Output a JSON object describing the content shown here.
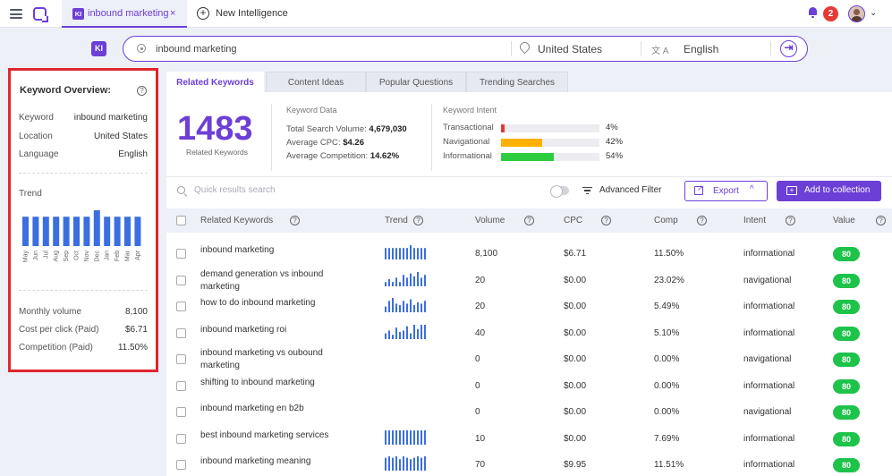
{
  "header": {
    "active_tab": {
      "badge": "KI",
      "label": "inbound marketing",
      "close": "×"
    },
    "new_tab_label": "New Intelligence",
    "new_tab_icon": "+",
    "notification_count": "2",
    "avatar_caret": "⌄"
  },
  "search": {
    "badge": "KI",
    "keyword": "inbound marketing",
    "location": "United States",
    "language_icon": "文 A",
    "language": "English",
    "submit_icon": "⇥"
  },
  "overview": {
    "title": "Keyword Overview:",
    "help": "?",
    "keyword_label": "Keyword",
    "keyword_value": "inbound marketing",
    "location_label": "Location",
    "location_value": "United States",
    "language_label": "Language",
    "language_value": "English",
    "trend_label": "Trend",
    "trend_months": [
      "May",
      "Jun",
      "Jul",
      "Aug",
      "Sep",
      "Oct",
      "Nov",
      "Dec",
      "Jan",
      "Feb",
      "Mar",
      "Apr"
    ],
    "trend_values": [
      0.82,
      0.82,
      0.82,
      0.82,
      0.82,
      0.82,
      0.82,
      1.0,
      0.82,
      0.82,
      0.82,
      0.82
    ],
    "monthly_volume_label": "Monthly volume",
    "monthly_volume_value": "8,100",
    "cpc_label": "Cost per click (Paid)",
    "cpc_value": "$6.71",
    "competition_label": "Competition (Paid)",
    "competition_value": "11.50%"
  },
  "tabs": [
    {
      "label": "Related Keywords",
      "active": true
    },
    {
      "label": "Content Ideas",
      "active": false
    },
    {
      "label": "Popular Questions",
      "active": false
    },
    {
      "label": "Trending Searches",
      "active": false
    }
  ],
  "summary": {
    "count": "1483",
    "count_label": "Related Keywords",
    "keyword_data_title": "Keyword Data",
    "total_volume_label": "Total Search Volume:",
    "total_volume_value": "4,679,030",
    "avg_cpc_label": "Average CPC:",
    "avg_cpc_value": "$4.26",
    "avg_comp_label": "Average Competition:",
    "avg_comp_value": "14.62%",
    "intent_title": "Keyword Intent",
    "intents": [
      {
        "label": "Transactional",
        "percent": "4%",
        "fraction": 0.04,
        "color": "#e53935"
      },
      {
        "label": "Navigational",
        "percent": "42%",
        "fraction": 0.42,
        "color": "#ffb000"
      },
      {
        "label": "Informational",
        "percent": "54%",
        "fraction": 0.54,
        "color": "#2ecc40"
      }
    ]
  },
  "toolbar": {
    "search_placeholder": "Quick results search",
    "advanced_filter": "Advanced Filter",
    "export_label": "Export",
    "export_caret": "^",
    "add_collection_label": "Add to collection",
    "add_collection_icon": "+"
  },
  "table": {
    "columns": [
      "Related Keywords",
      "Trend",
      "Volume",
      "CPC",
      "Comp",
      "Intent",
      "Value"
    ],
    "help": "?",
    "rows": [
      {
        "keyword": "inbound marketing",
        "volume": "8,100",
        "cpc": "$6.71",
        "comp": "11.50%",
        "intent": "informational",
        "value": "80",
        "trend": [
          0.8,
          0.8,
          0.8,
          0.8,
          0.8,
          0.8,
          0.8,
          1,
          0.8,
          0.8,
          0.8,
          0.8
        ]
      },
      {
        "keyword": "demand generation vs inbound marketing",
        "volume": "20",
        "cpc": "$0.00",
        "comp": "23.02%",
        "intent": "navigational",
        "value": "80",
        "trend": [
          0.3,
          0.5,
          0.3,
          0.6,
          0.3,
          0.8,
          0.6,
          0.9,
          0.7,
          1,
          0.6,
          0.8
        ]
      },
      {
        "keyword": "how to do inbound marketing",
        "volume": "20",
        "cpc": "$0.00",
        "comp": "5.49%",
        "intent": "informational",
        "value": "80",
        "trend": [
          0.4,
          0.8,
          1,
          0.6,
          0.5,
          0.8,
          0.6,
          0.9,
          0.5,
          0.7,
          0.6,
          0.8
        ]
      },
      {
        "keyword": "inbound marketing roi",
        "volume": "40",
        "cpc": "$0.00",
        "comp": "5.10%",
        "intent": "informational",
        "value": "80",
        "trend": [
          0.4,
          0.6,
          0.3,
          0.8,
          0.5,
          0.6,
          0.9,
          0.4,
          1,
          0.7,
          1,
          1
        ]
      },
      {
        "keyword": "inbound marketing vs oubound marketing",
        "volume": "0",
        "cpc": "$0.00",
        "comp": "0.00%",
        "intent": "navigational",
        "value": "80",
        "trend": []
      },
      {
        "keyword": "shifting to inbound marketing",
        "volume": "0",
        "cpc": "$0.00",
        "comp": "0.00%",
        "intent": "informational",
        "value": "80",
        "trend": []
      },
      {
        "keyword": "inbound marketing en b2b",
        "volume": "0",
        "cpc": "$0.00",
        "comp": "0.00%",
        "intent": "navigational",
        "value": "80",
        "trend": []
      },
      {
        "keyword": "best inbound marketing services",
        "volume": "10",
        "cpc": "$0.00",
        "comp": "7.69%",
        "intent": "informational",
        "value": "80",
        "trend": [
          1,
          1,
          1,
          1,
          1,
          1,
          1,
          1,
          1,
          1,
          1,
          1
        ]
      },
      {
        "keyword": "inbound marketing meaning",
        "volume": "70",
        "cpc": "$9.95",
        "comp": "11.51%",
        "intent": "informational",
        "value": "80",
        "trend": [
          0.9,
          1,
          0.9,
          1,
          0.8,
          1,
          0.9,
          0.8,
          0.9,
          1,
          0.9,
          1
        ]
      }
    ]
  },
  "colors": {
    "accent": "#6c3fd6",
    "highlight_border": "#e0262e",
    "value_badge": "#1ec34a",
    "trend_bar": "#3b6fe0"
  }
}
